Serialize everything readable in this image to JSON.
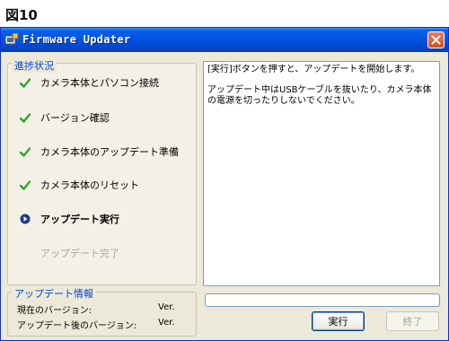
{
  "figure_label": "図10",
  "window": {
    "title": "Firmware Updater"
  },
  "progress_group": {
    "legend": "進捗状況",
    "steps": [
      {
        "label": "カメラ本体とパソコン接続",
        "state": "done"
      },
      {
        "label": "バージョン確認",
        "state": "done"
      },
      {
        "label": "カメラ本体のアップデート準備",
        "state": "done"
      },
      {
        "label": "カメラ本体のリセット",
        "state": "done"
      },
      {
        "label": "アップデート実行",
        "state": "current"
      },
      {
        "label": "アップデート完了",
        "state": "pending"
      }
    ]
  },
  "message": {
    "line1": "[実行]ボタンを押すと、アップデートを開始します。",
    "line2": "アップデート中はUSBケーブルを抜いたり、カメラ本体の電源を切ったりしないでください。"
  },
  "update_info": {
    "legend": "アップデート情報",
    "current_label": "現在のバージョン:",
    "current_value": "Ver.",
    "after_label": "アップデート後のバージョン:",
    "after_value": "Ver."
  },
  "progress": {
    "value": 0
  },
  "buttons": {
    "execute": "実行",
    "finish": "終了"
  },
  "colors": {
    "check": "#2aa52a",
    "current_marker": "#1c3a8c",
    "group_legend": "#0046d5"
  }
}
